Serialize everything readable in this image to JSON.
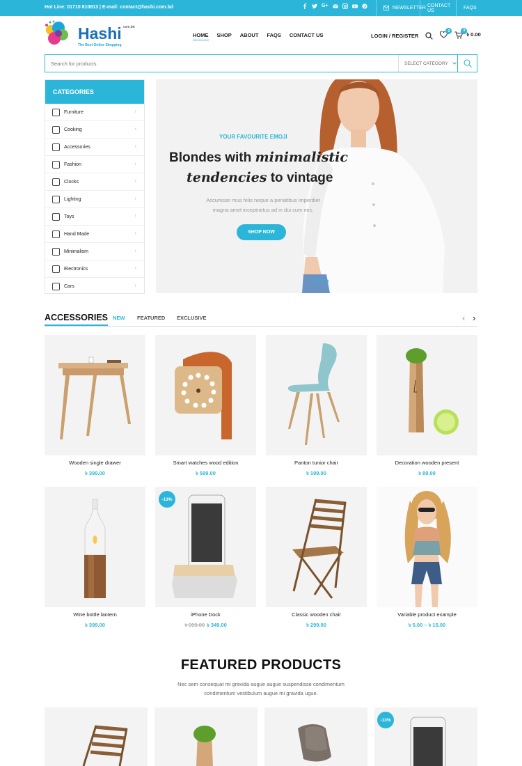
{
  "topbar": {
    "hotline": "Hot Line: 01710 810813 | E-mail: contact@hashi.com.bd",
    "newsletter": "NEWSLETTER",
    "contact": "CONTACT US",
    "faqs": "FAQS"
  },
  "header": {
    "logo_name": "Hashi",
    "logo_suffix": "com.bd",
    "logo_tagline": "The Best Online Shopping",
    "nav": [
      "HOME",
      "SHOP",
      "ABOUT",
      "FAQS",
      "CONTACT US"
    ],
    "login": "LOGIN / REGISTER",
    "wishlist_count": "0",
    "cart_count": "0",
    "cart_total": "৳ 0.00"
  },
  "search": {
    "placeholder": "Search for products",
    "category": "SELECT CATEGORY"
  },
  "categories": {
    "title": "CATEGORIES",
    "items": [
      "Furniture",
      "Cooking",
      "Accessories",
      "Fashion",
      "Clocks",
      "Lighting",
      "Toys",
      "Hand Made",
      "Minimalism",
      "Electronics",
      "Cars"
    ]
  },
  "hero": {
    "eyebrow": "YOUR FAVOURITE EMOJI",
    "line1_a": "Blondes with ",
    "line1_b": "minimalistic",
    "line2_a": "tendencies",
    "line2_b": " to vintage",
    "sub1": "Accumsan mus felis neque a penatibus imperdiet",
    "sub2": "magna amet inceptnetus ad in dui cum nec.",
    "button": "SHOP NOW"
  },
  "accessories": {
    "title": "ACCESSORIES",
    "tabs": [
      "NEW",
      "FEATURED",
      "EXCLUSIVE"
    ],
    "products": [
      {
        "name": "Wooden single drawer",
        "price": "৳ 399.00"
      },
      {
        "name": "Smart watches wood edition",
        "price": "৳ 599.00"
      },
      {
        "name": "Panton tunior chair",
        "price": "৳ 199.00"
      },
      {
        "name": "Decoration wooden present",
        "price": "৳ 89.00"
      },
      {
        "name": "Wine bottle lantern",
        "price": "৳ 399.00"
      },
      {
        "name": "iPhone Dock",
        "old_price": "৳ 399.00",
        "price": "৳ 349.00",
        "sale": "-13%"
      },
      {
        "name": "Classic wooden chair",
        "price": "৳ 299.00"
      },
      {
        "name": "Variable product example",
        "price": "৳ 5.00 – ৳ 15.00"
      }
    ]
  },
  "featured": {
    "title": "FEATURED PRODUCTS",
    "desc1": "Nec sem consequat mi gravida augue augue suspendisse condimentum",
    "desc2": "condimentum vestibulum augue mi gravida ugue.",
    "sale": "-13%"
  },
  "colors": {
    "accent": "#2bb6d9"
  }
}
